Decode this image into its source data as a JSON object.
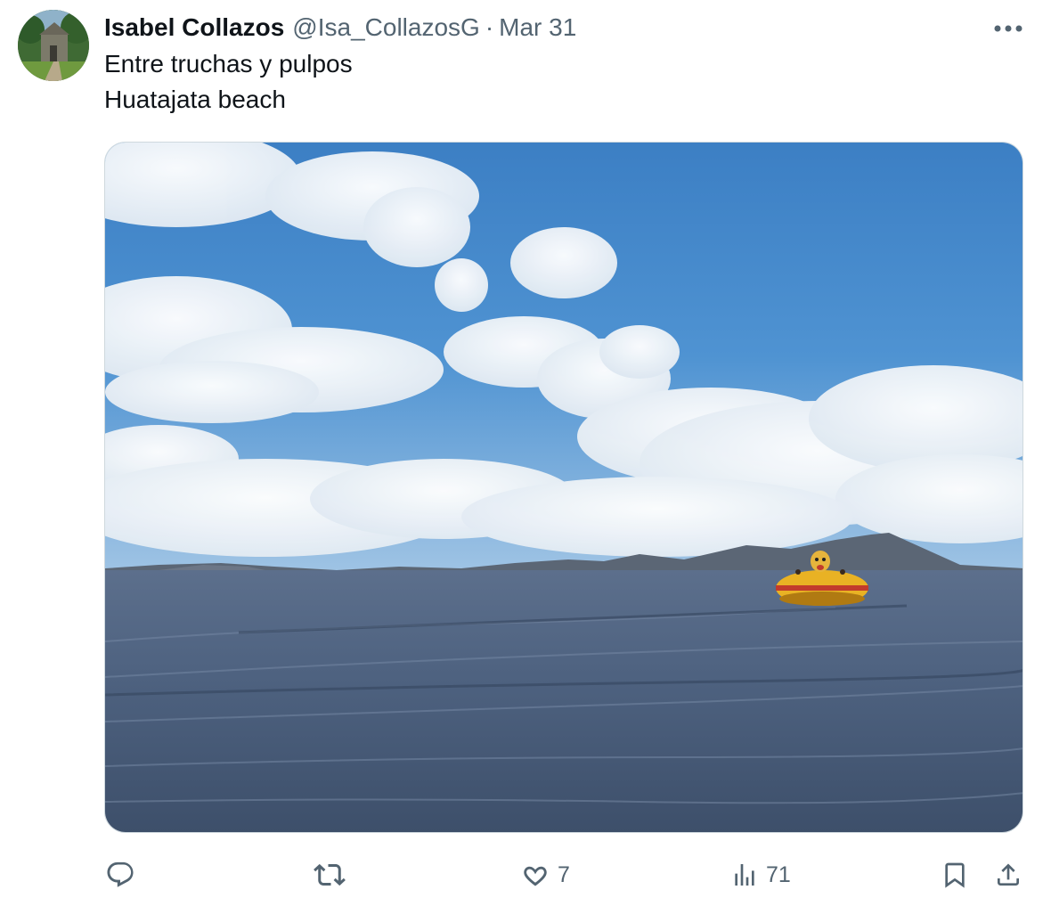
{
  "post": {
    "author_name": "Isabel Collazos",
    "handle": "@Isa_CollazosG",
    "separator": "·",
    "date": "Mar 31",
    "text_lines": [
      "Entre truchas y pulpos",
      "Huatajata beach"
    ]
  },
  "icons": {
    "more": "more-horizontal-icon",
    "reply": "reply-icon",
    "repost": "repost-icon",
    "like": "heart-icon",
    "views": "views-chart-icon",
    "bookmark": "bookmark-icon",
    "share": "share-icon"
  },
  "actions": {
    "likes": "7",
    "views": "71"
  },
  "colors": {
    "text": "#0f1419",
    "muted": "#536471",
    "sky": "#3f86c9",
    "lake": "#4a5d78",
    "boat": "#e9b224"
  }
}
